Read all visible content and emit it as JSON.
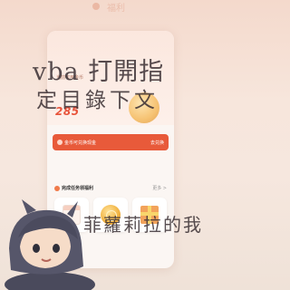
{
  "app": {
    "top_ghost_text": "福利"
  },
  "hero": {
    "small_text": "当前可用金币",
    "amount": "285"
  },
  "strip": {
    "left_label": "金币可兑换现金",
    "right_label": "去兑换"
  },
  "tasks": {
    "title": "完成任务领福利",
    "more": "更多 >",
    "tiles": [
      {
        "icon": "calendar-icon"
      },
      {
        "icon": "coin-icon"
      },
      {
        "icon": "gift-icon"
      }
    ]
  },
  "overlay": {
    "line1": "vba 打開指",
    "line2": "定目錄下文",
    "line3": "菲蘿莉拉的我"
  },
  "colors": {
    "accent": "#e85a3a",
    "amount": "#e8543b",
    "background": "#f6e7de"
  }
}
